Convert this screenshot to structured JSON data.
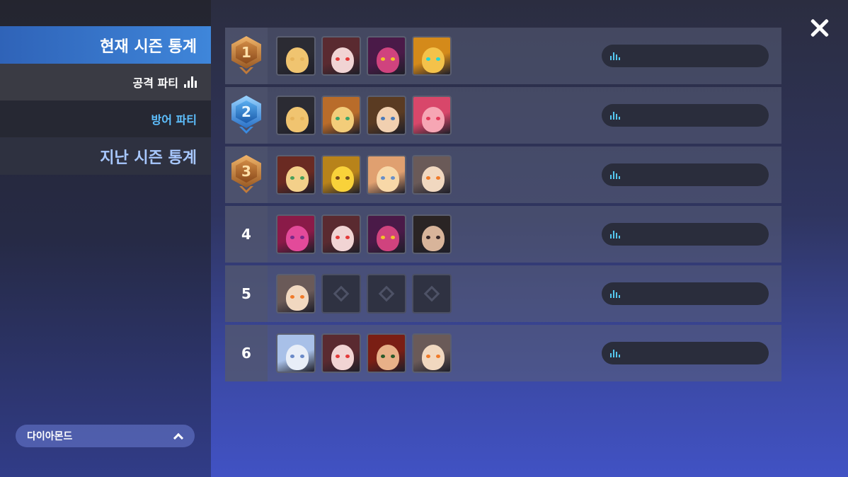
{
  "sidebar": {
    "current_season_label": "현재 시즌 통계",
    "attack_party_label": "공격 파티",
    "defense_party_label": "방어 파티",
    "past_season_label": "지난 시즌 통계",
    "tier_select": {
      "selected": "다이아몬드",
      "icon": "chevron-up-icon"
    }
  },
  "close_icon": "close-icon",
  "colors": {
    "accent_blue": "#3f86da",
    "defense_text": "#5ec0ff",
    "stat_bars": "#55c8f0"
  },
  "ranks": [
    {
      "rank": "1",
      "badge": "bronze",
      "portraits": [
        "blonde-knight",
        "white-hair-red-eyes",
        "pink-hair-purple",
        "blonde-goggles"
      ]
    },
    {
      "rank": "2",
      "badge": "blue",
      "portraits": [
        "blonde-knight",
        "blonde-circlet",
        "brown-hat",
        "pink-hair-tiara"
      ]
    },
    {
      "rank": "3",
      "badge": "bronze",
      "portraits": [
        "blonde-ribbon",
        "yellow-hair",
        "blonde-smile",
        "silver-hair-orange-eyes"
      ]
    },
    {
      "rank": "4",
      "badge": "none",
      "portraits": [
        "magenta-hair-rose",
        "white-hair-red-eyes",
        "pink-hair-purple",
        "dark-hair-man"
      ]
    },
    {
      "rank": "5",
      "badge": "none",
      "portraits": [
        "silver-hair-orange-eyes",
        "empty",
        "empty",
        "empty"
      ]
    },
    {
      "rank": "6",
      "badge": "none",
      "portraits": [
        "light-blue-hair",
        "white-hair-red-eyes",
        "red-hair",
        "silver-hair-orange-eyes"
      ]
    }
  ]
}
